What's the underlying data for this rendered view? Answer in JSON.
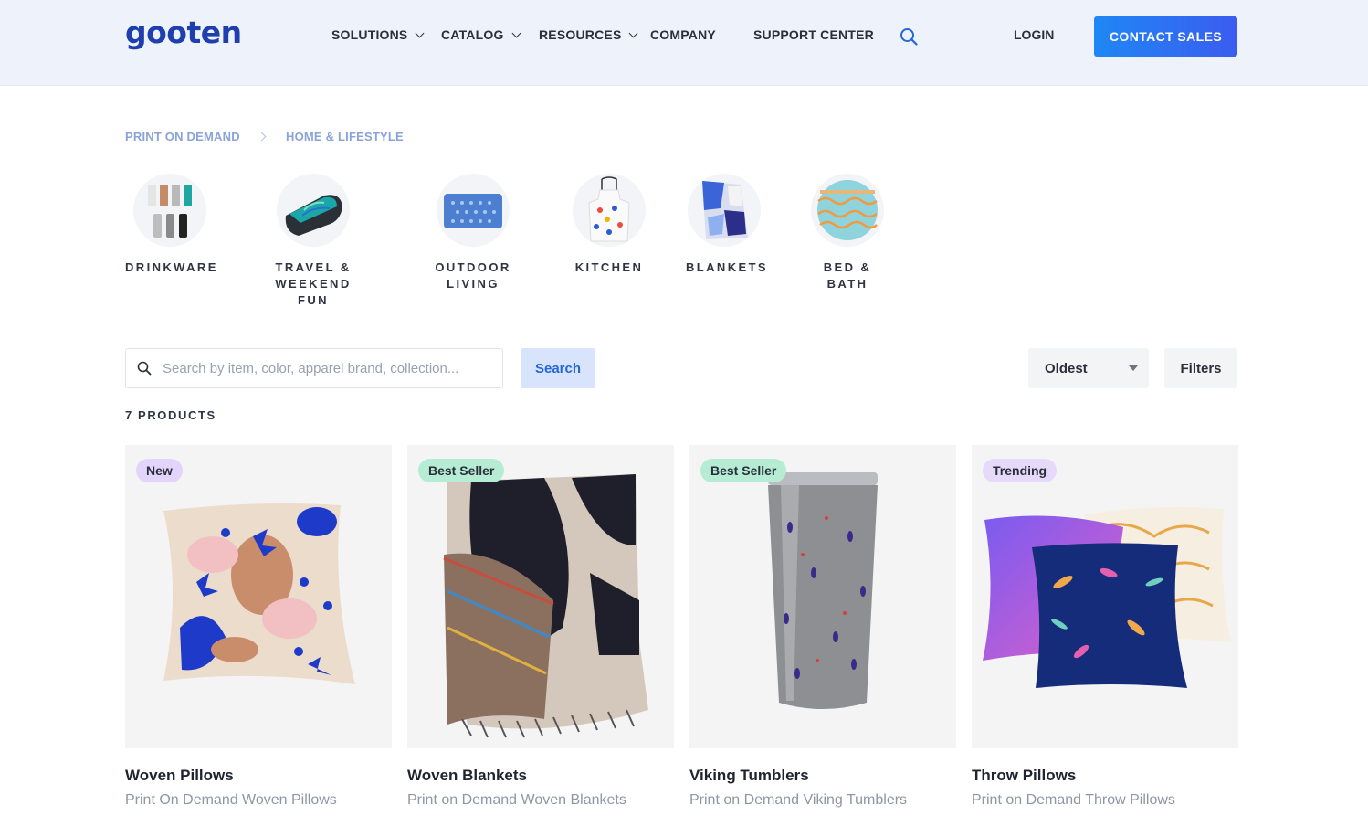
{
  "header": {
    "logo": "gooten",
    "nav": [
      "SOLUTIONS",
      "CATALOG",
      "RESOURCES",
      "COMPANY",
      "SUPPORT CENTER"
    ],
    "login": "LOGIN",
    "cta": "CONTACT SALES",
    "icons": {
      "search": "search-icon",
      "dropdown": "chevron-down-icon"
    }
  },
  "breadcrumb": [
    "PRINT ON DEMAND",
    "HOME & LIFESTYLE"
  ],
  "categories": [
    {
      "line1": "DRINKWARE",
      "line2": ""
    },
    {
      "line1": "TRAVEL &",
      "line2": "WEEKEND FUN"
    },
    {
      "line1": "OUTDOOR",
      "line2": "LIVING"
    },
    {
      "line1": "KITCHEN",
      "line2": ""
    },
    {
      "line1": "BLANKETS",
      "line2": ""
    },
    {
      "line1": "BED & BATH",
      "line2": ""
    }
  ],
  "search": {
    "placeholder": "Search by item, color, apparel brand, collection...",
    "value": "",
    "button": "Search"
  },
  "sort": {
    "selected": "Oldest"
  },
  "filters": "Filters",
  "product_count": "7 PRODUCTS",
  "products": [
    {
      "badge": "New",
      "title": "Woven Pillows",
      "subtitle": "Print On Demand Woven Pillows"
    },
    {
      "badge": "Best Seller",
      "title": "Woven Blankets",
      "subtitle": "Print on Demand Woven Blankets"
    },
    {
      "badge": "Best Seller",
      "title": "Viking Tumblers",
      "subtitle": "Print on Demand Viking Tumblers"
    },
    {
      "badge": "Trending",
      "title": "Throw Pillows",
      "subtitle": "Print on Demand Throw Pillows"
    }
  ],
  "colors": {
    "brand": "#1f3fae",
    "cta": "#2f6df2",
    "header_bg": "#eef3fb",
    "breadcrumb": "#8aa3d8"
  }
}
